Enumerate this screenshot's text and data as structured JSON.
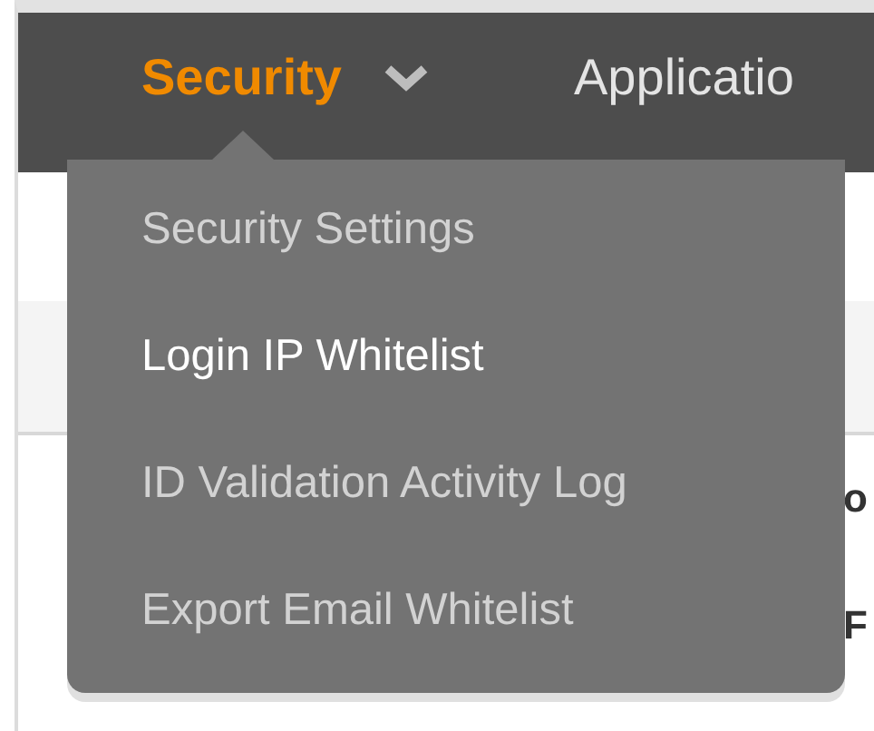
{
  "nav": {
    "items": [
      {
        "label": "Security",
        "selected": true,
        "has_menu": true
      },
      {
        "label": "Applicatio",
        "selected": false,
        "has_menu": false
      }
    ]
  },
  "menu": {
    "items": [
      {
        "label": "Security Settings",
        "selected": false
      },
      {
        "label": "Login IP Whitelist",
        "selected": true
      },
      {
        "label": "ID Validation Activity Log",
        "selected": false
      },
      {
        "label": "Export Email Whitelist",
        "selected": false
      }
    ]
  },
  "page": {
    "rows": [
      "o",
      "F"
    ]
  }
}
